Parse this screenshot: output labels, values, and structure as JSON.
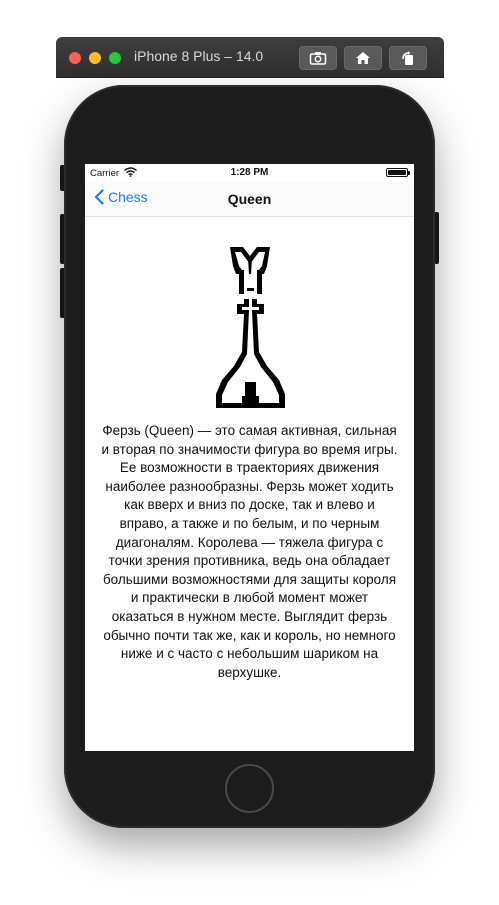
{
  "simulator": {
    "title": "iPhone 8 Plus – 14.0",
    "buttons": [
      "screenshot-icon",
      "home-icon",
      "rotate-icon"
    ]
  },
  "status_bar": {
    "carrier": "Carrier",
    "time": "1:28 PM",
    "battery_level": 1.0
  },
  "nav": {
    "back_label": "Chess",
    "title": "Queen"
  },
  "content": {
    "image_icon": "chess-queen-icon",
    "description": "Ферзь (Queen) — это самая активная, сильная и вторая по значимости фигура во время игры. Ее возможности в траекториях движения наиболее разнообразны. Ферзь может ходить как вверх и вниз по доске, так и влево и вправо, а также и по белым, и по черным диагоналям. Королева — тяжела фигура с точки зрения противника, ведь она обладает большими возможностями для защиты короля и практически в любой момент может оказаться в нужном месте. Выглядит ферзь обычно почти так же, как и король, но немного ниже и с часто с небольшим шариком на верхушке."
  },
  "colors": {
    "accent": "#1a7cf5",
    "phone_body": "#1c1c1c"
  }
}
